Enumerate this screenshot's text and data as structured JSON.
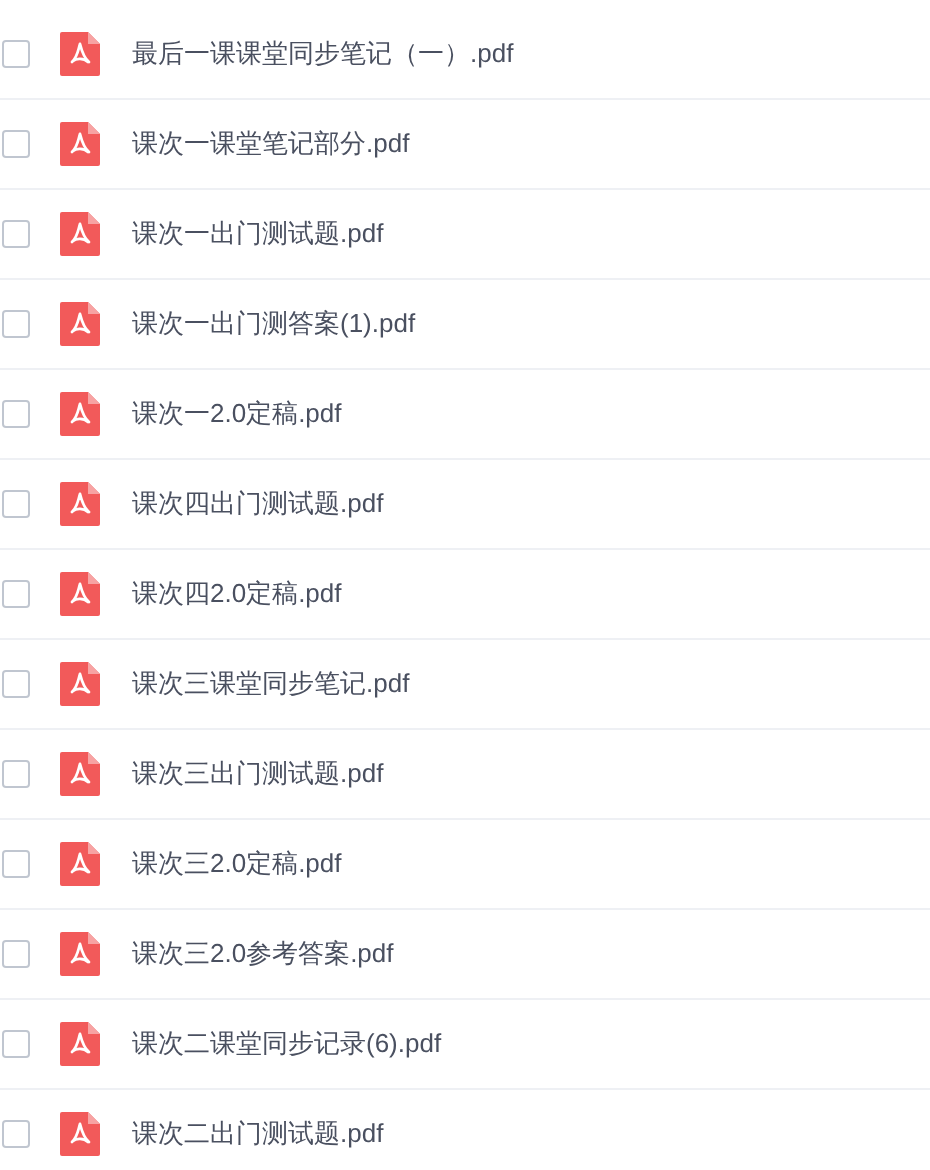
{
  "files": [
    {
      "name": "最后一课课堂同步笔记（一）.pdf",
      "checked": false
    },
    {
      "name": "课次一课堂笔记部分.pdf",
      "checked": false
    },
    {
      "name": "课次一出门测试题.pdf",
      "checked": false
    },
    {
      "name": "课次一出门测答案(1).pdf",
      "checked": false
    },
    {
      "name": "课次一2.0定稿.pdf",
      "checked": false
    },
    {
      "name": "课次四出门测试题.pdf",
      "checked": false
    },
    {
      "name": "课次四2.0定稿.pdf",
      "checked": false
    },
    {
      "name": "课次三课堂同步笔记.pdf",
      "checked": false
    },
    {
      "name": "课次三出门测试题.pdf",
      "checked": false
    },
    {
      "name": "课次三2.0定稿.pdf",
      "checked": false
    },
    {
      "name": "课次三2.0参考答案.pdf",
      "checked": false
    },
    {
      "name": "课次二课堂同步记录(6).pdf",
      "checked": false
    },
    {
      "name": "课次二出门测试题.pdf",
      "checked": false
    }
  ]
}
